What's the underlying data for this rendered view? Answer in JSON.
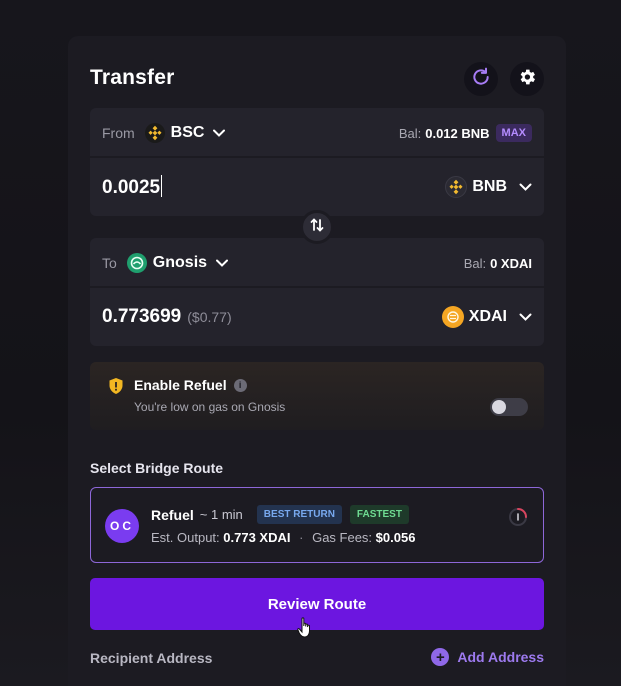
{
  "header": {
    "title": "Transfer"
  },
  "from": {
    "label": "From",
    "chain": "BSC",
    "balance_label": "Bal:",
    "balance_value": "0.012 BNB",
    "max_label": "MAX",
    "amount": "0.0025",
    "token": "BNB"
  },
  "to": {
    "label": "To",
    "chain": "Gnosis",
    "balance_label": "Bal:",
    "balance_value": "0 XDAI",
    "amount": "0.773699",
    "amount_usd": "($0.77)",
    "token": "XDAI"
  },
  "refuel": {
    "title": "Enable Refuel",
    "subtitle": "You're low on gas on Gnosis",
    "enabled": false
  },
  "route_section": {
    "title": "Select Bridge Route",
    "route": {
      "logo_text": "OC",
      "name": "Refuel",
      "time": "~ 1 min",
      "badge_best": "BEST RETURN",
      "badge_fast": "FASTEST",
      "output_label": "Est. Output:",
      "output_value": "0.773 XDAI",
      "separator": "·",
      "fees_label": "Gas Fees:",
      "fees_value": "$0.056"
    }
  },
  "review_button": {
    "label": "Review Route"
  },
  "recipient": {
    "label": "Recipient Address",
    "add_label": "Add Address",
    "add_icon": "+"
  },
  "icons": {
    "refresh": "refresh-icon",
    "settings": "gear-icon",
    "swap": "swap-direction-icon",
    "bsc": "bsc-chain-icon",
    "gnosis": "gnosis-chain-icon",
    "bnb": "bnb-token-icon",
    "xdai": "xdai-token-icon",
    "shield": "shield-icon"
  },
  "colors": {
    "accent": "#6c16e0",
    "route_border": "#8d67d8",
    "bnb_yellow": "#f3ba2f",
    "gnosis_green": "#1f9f6e",
    "xdai_orange": "#f5a623"
  }
}
